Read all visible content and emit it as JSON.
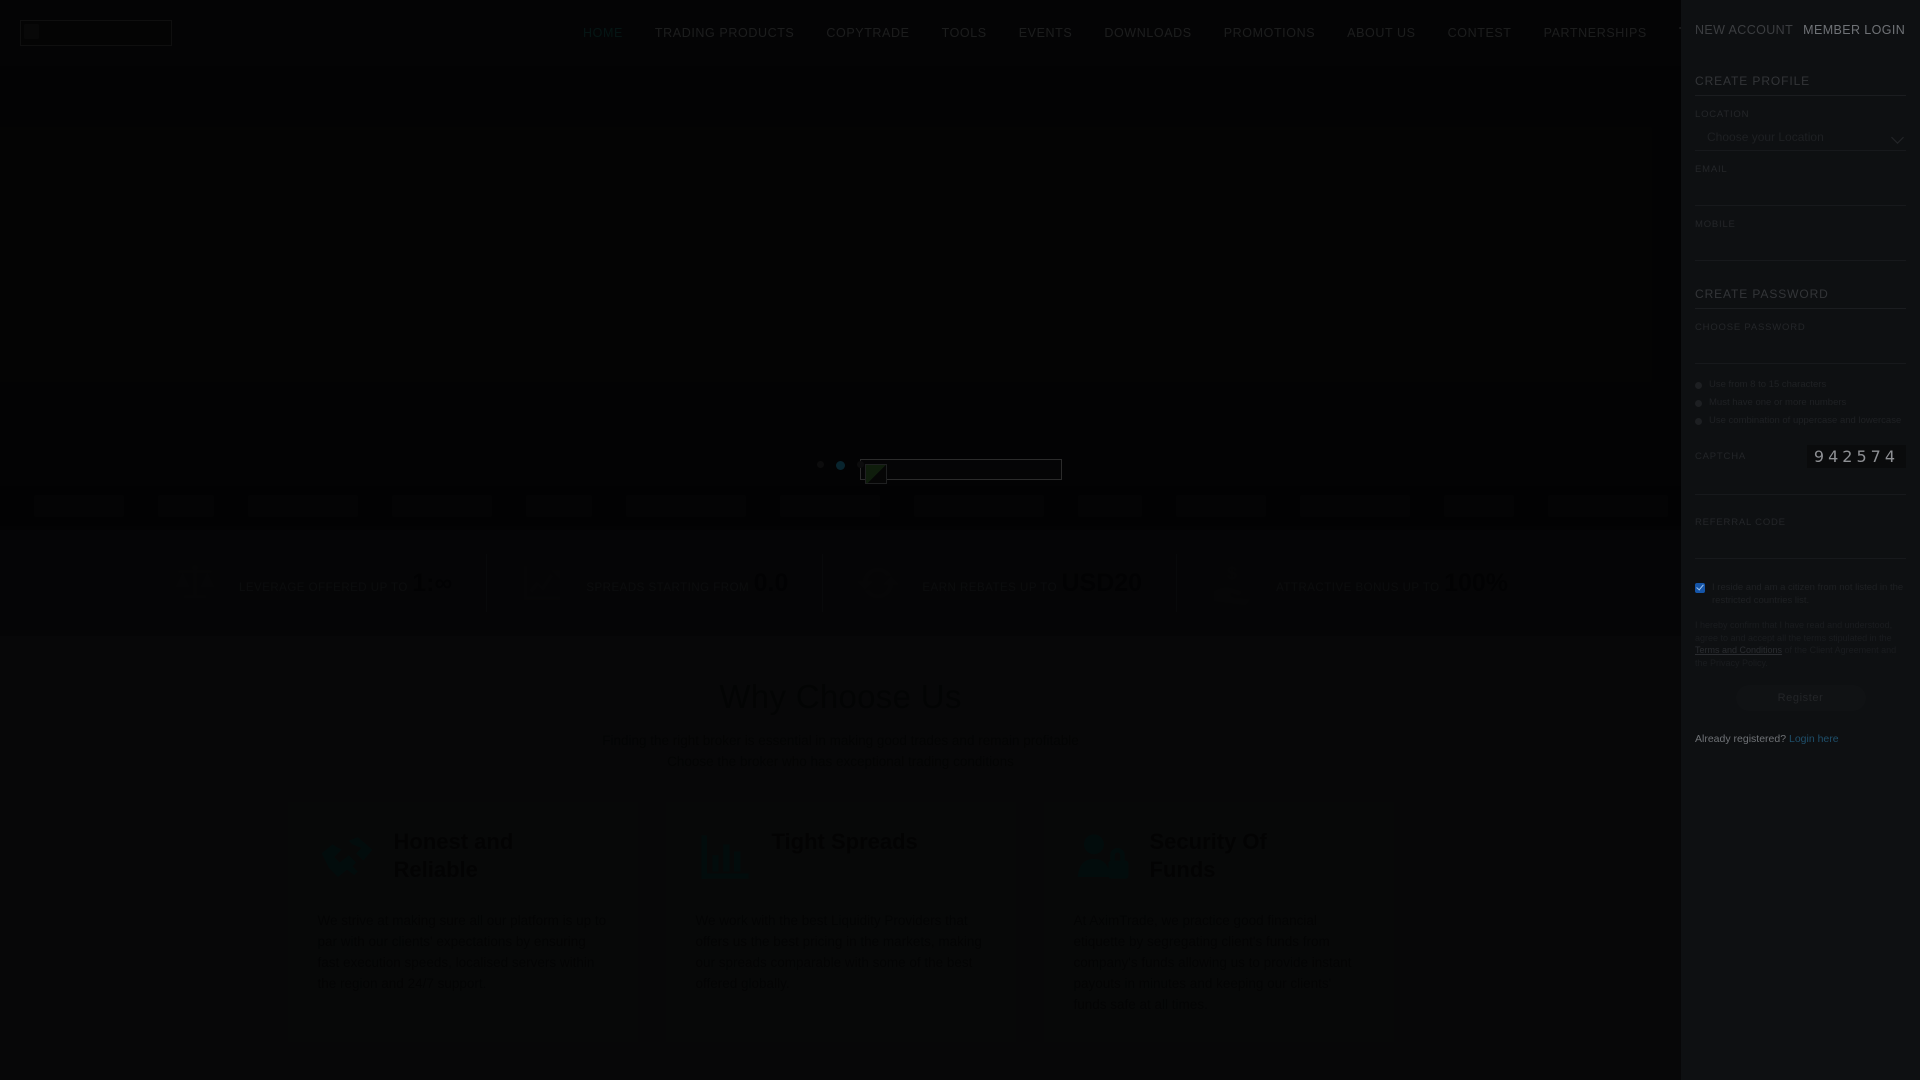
{
  "header": {
    "logo_alt": "AximTrade",
    "nav": [
      {
        "label": "HOME",
        "active": true
      },
      {
        "label": "TRADING PRODUCTS",
        "active": false
      },
      {
        "label": "COPYTRADE",
        "active": false
      },
      {
        "label": "TOOLS",
        "active": false
      },
      {
        "label": "EVENTS",
        "active": false
      },
      {
        "label": "DOWNLOADS",
        "active": false
      },
      {
        "label": "PROMOTIONS",
        "active": false
      },
      {
        "label": "ABOUT US",
        "active": false
      },
      {
        "label": "CONTEST",
        "active": false
      },
      {
        "label": "PARTNERSHIPS",
        "active": false
      }
    ]
  },
  "hero": {
    "slide_count": 3,
    "active_slide": 2
  },
  "stats": [
    {
      "caption": "LEVERAGE OFFERED UP TO",
      "value": "1:∞",
      "icon": "scales-icon"
    },
    {
      "caption": "SPREADS STARTING FROM",
      "value": "0.0",
      "icon": "chart-line-icon"
    },
    {
      "caption": "EARN REBATES UP TO",
      "value": "USD20",
      "icon": "refresh-icon"
    },
    {
      "caption": "ATTRACTIVE BONUS UP TO",
      "value": "100%",
      "icon": "hand-dollar-icon"
    }
  ],
  "why": {
    "title": "Why Choose Us",
    "subtitle_line1": "Finding the right broker is essential in making good trades and remain profitable",
    "subtitle_line2": "Choose the broker who has exceptional trading conditions",
    "cards": [
      {
        "icon": "handshake-icon",
        "title": "Honest and Reliable",
        "body": "We strive at making sure all our platform is up to par with our clients' expectations by ensuring fast execution speeds, localised servers within the region and 24/7 support."
      },
      {
        "icon": "bar-chart-icon",
        "title": "Tight Spreads",
        "body": "We work with the best Liquidity Providers that offers us the best pricing in the markets, making our spreads comparable with some of the best offered globally."
      },
      {
        "icon": "user-lock-icon",
        "title": "Security Of Funds",
        "body": "At AximTrade, we practice good financial etiquette by segregating client's funds from company's funds allowing us to provide instant payouts in minutes and keeping our clients' funds safe at all times."
      }
    ]
  },
  "panel": {
    "tab_new_account": "NEW ACCOUNT",
    "tab_member_login": "MEMBER LOGIN",
    "section_profile": "CREATE PROFILE",
    "location_label": "LOCATION",
    "location_placeholder": "Choose your Location",
    "location_value": "",
    "email_label": "EMAIL",
    "email_value": "",
    "mobile_label": "MOBILE",
    "mobile_value": "",
    "section_password": "CREATE PASSWORD",
    "password_label": "CHOOSE PASSWORD",
    "password_value": "",
    "password_rules": [
      "Use from 8 to 15 characters",
      "Must have one or more numbers",
      "Use combination of uppercase and lowercase"
    ],
    "captcha_label": "CAPTCHA",
    "captcha_code": "942574",
    "captcha_value": "",
    "referral_label": "REFERRAL CODE",
    "referral_value": "",
    "terms_checked": true,
    "terms_text": "I reside and am a citizen from not listed in the restricted countries list.",
    "legal_text_pre": "I hereby confirm that I have read and understood, agree to and accept all the terms stipulated in the ",
    "legal_link": "Terms and Conditions",
    "legal_text_post": " of the Client Agreement and the Privacy Policy.",
    "register_button": "Register",
    "already_text": "Already registered?",
    "already_link": "Login here",
    "accent_color": "#2bb2e3",
    "checkbox_color": "#1555a8"
  }
}
